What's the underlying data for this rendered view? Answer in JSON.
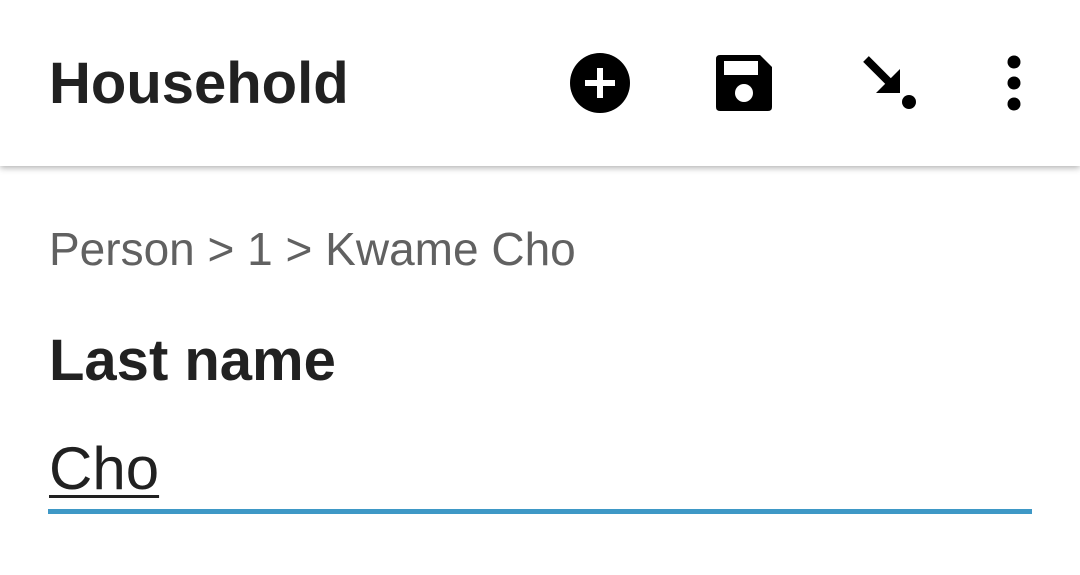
{
  "toolbar": {
    "title": "Household",
    "actions": [
      {
        "name": "add",
        "icon": "add-circle-icon"
      },
      {
        "name": "save",
        "icon": "save-icon"
      },
      {
        "name": "goto",
        "icon": "arrow-down-right-icon"
      },
      {
        "name": "more",
        "icon": "more-vert-icon"
      }
    ]
  },
  "breadcrumb": {
    "text": "Person > 1 > Kwame Cho"
  },
  "field": {
    "label": "Last name",
    "value": "Cho"
  },
  "colors": {
    "accent": "#3e98c6",
    "text_primary": "#212121",
    "text_secondary": "#616161",
    "background": "#ffffff"
  }
}
